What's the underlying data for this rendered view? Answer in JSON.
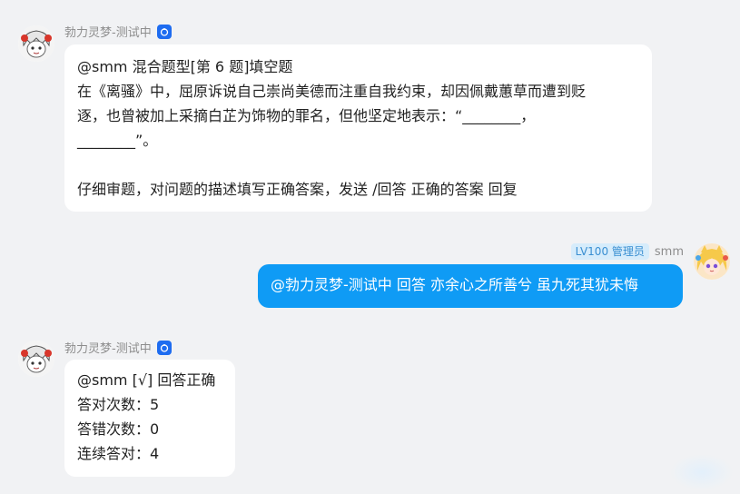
{
  "messages": [
    {
      "sender": "勃力灵梦-测试中",
      "bot_icon": "bot-badge-icon",
      "avatar_icon": "robot-girl-avatar-icon",
      "lines": [
        "@smm 混合题型[第 6 题]填空题",
        "在《离骚》中，屈原诉说自己崇尚美德而注重自我约束，却因佩戴蕙草而遭到贬",
        "逐，也曾被加上采摘白芷为饰物的罪名，但他坚定地表示：“________，",
        "________”。",
        "",
        "仔细审题，对问题的描述填写正确答案，发送 /回答 正确的答案 回复"
      ]
    },
    {
      "sender": "smm",
      "level": "LV100 管理员",
      "avatar_icon": "anime-girl-avatar-icon",
      "text": "@勃力灵梦-测试中 回答 亦余心之所善兮 虽九死其犹未悔"
    },
    {
      "sender": "勃力灵梦-测试中",
      "bot_icon": "bot-badge-icon",
      "avatar_icon": "robot-girl-avatar-icon",
      "lines": [
        "@smm [√] 回答正确",
        "答对次数：5",
        "答错次数：0",
        "连续答对：4"
      ]
    }
  ]
}
